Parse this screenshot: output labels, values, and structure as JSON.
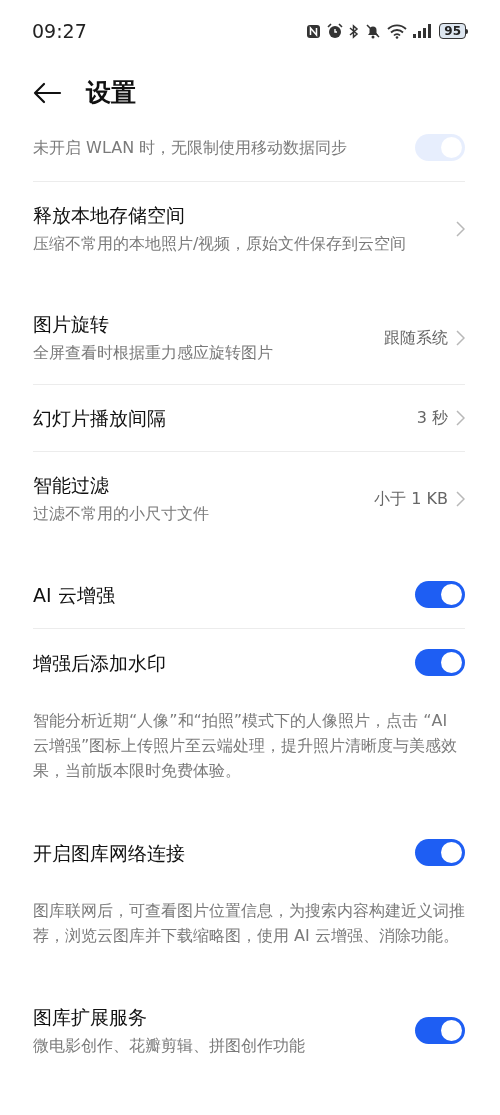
{
  "status_bar": {
    "time": "09:27",
    "battery": "95"
  },
  "header": {
    "title": "设置"
  },
  "groups": [
    {
      "items": [
        {
          "kind": "toggle",
          "description": "未开启 WLAN 时，无限制使用移动数据同步",
          "on": true,
          "faded": true
        },
        {
          "kind": "link",
          "title": "释放本地存储空间",
          "description": "压缩不常用的本地照片/视频，原始文件保存到云空间"
        }
      ]
    },
    {
      "items": [
        {
          "kind": "link",
          "title": "图片旋转",
          "description": "全屏查看时根据重力感应旋转图片",
          "value": "跟随系统"
        },
        {
          "kind": "link",
          "title": "幻灯片播放间隔",
          "value": "3 秒"
        },
        {
          "kind": "link",
          "title": "智能过滤",
          "description": "过滤不常用的小尺寸文件",
          "value": "小于 1 KB"
        }
      ]
    },
    {
      "items": [
        {
          "kind": "toggle",
          "title": "AI 云增强",
          "on": true
        },
        {
          "kind": "toggle",
          "title": "增强后添加水印",
          "on": true
        }
      ],
      "note": "智能分析近期“人像”和“拍照”模式下的人像照片，点击 “AI 云增强”图标上传照片至云端处理，提升照片清晰度与美感效果，当前版本限时免费体验。"
    },
    {
      "items": [
        {
          "kind": "toggle",
          "title": "开启图库网络连接",
          "on": true
        }
      ],
      "note": "图库联网后，可查看图片位置信息，为搜索内容构建近义词推荐，浏览云图库并下载缩略图，使用 AI 云增强、消除功能。"
    },
    {
      "items": [
        {
          "kind": "toggle",
          "title": "图库扩展服务",
          "description": "微电影创作、花瓣剪辑、拼图创作功能",
          "on": true
        }
      ]
    }
  ]
}
